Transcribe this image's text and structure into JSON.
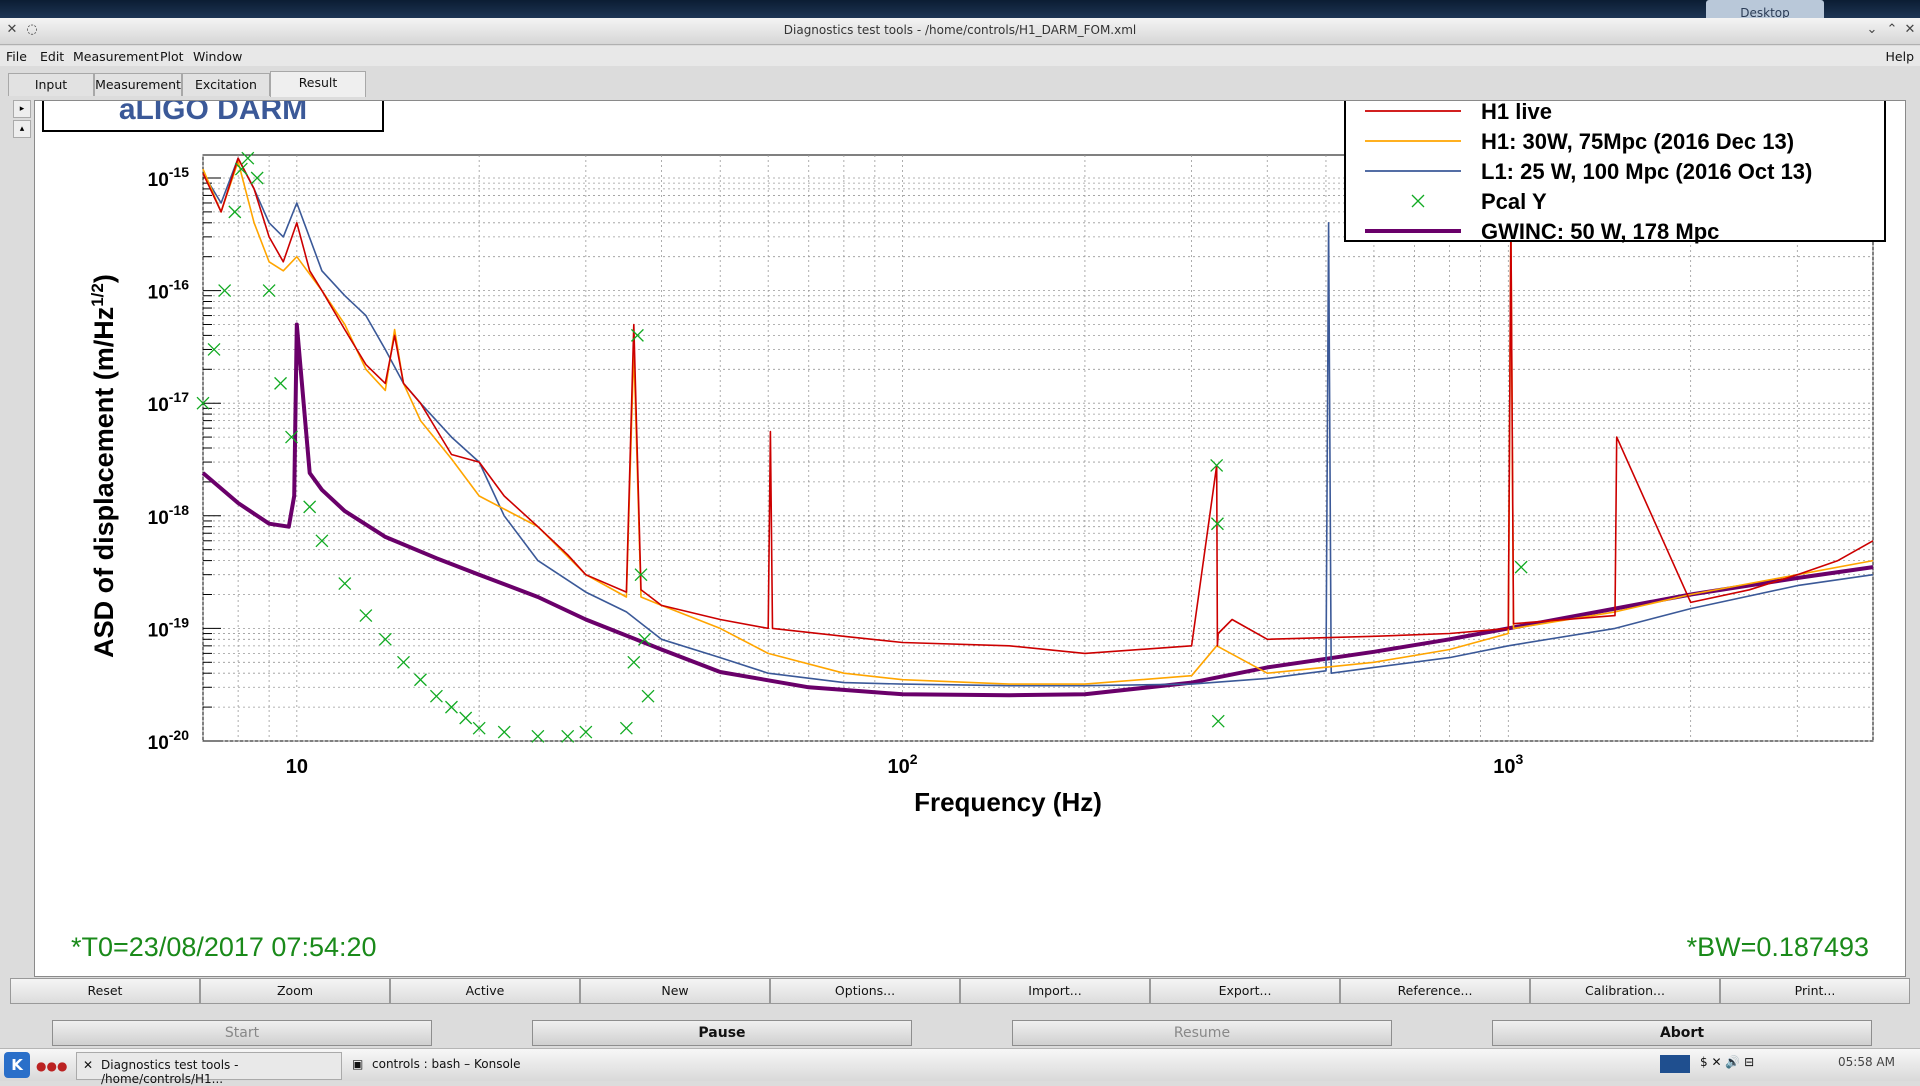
{
  "desktop_tab": "Desktop",
  "window_title": "Diagnostics test tools - /home/controls/H1_DARM_FOM.xml",
  "menu": [
    "File",
    "Edit",
    "Measurement",
    "Plot",
    "Window"
  ],
  "menu_help": "Help",
  "tabs": [
    "Input",
    "Measurement",
    "Excitation",
    "Result"
  ],
  "active_tab": "Result",
  "plot_title": "aLIGO DARM",
  "t0_label": "*T0=23/08/2017 07:54:20",
  "bw_label": "*BW=0.187493",
  "legend": [
    {
      "label": "H1 live",
      "color": "#cc0000",
      "kind": "line"
    },
    {
      "label": "H1: 30W, 75Mpc (2016 Dec 13)",
      "color": "#ffa500",
      "kind": "line"
    },
    {
      "label": "L1: 25 W, 100 Mpc (2016 Oct 13)",
      "color": "#3b5998",
      "kind": "line"
    },
    {
      "label": "Pcal Y",
      "color": "#11aa22",
      "kind": "marker"
    },
    {
      "label": "GWINC: 50 W, 178 Mpc",
      "color": "#6a006a",
      "kind": "thick"
    }
  ],
  "chart_data": {
    "type": "line",
    "xlabel": "Frequency (Hz)",
    "ylabel": "ASD of displacement (m/Hz^1/2)",
    "ylabel_main": "ASD of displacement (m/Hz",
    "ylabel_sup": "1/2",
    "ylabel_close": ")",
    "xscale": "log",
    "yscale": "log",
    "xlim": [
      7,
      4000
    ],
    "ylim": [
      1e-20,
      1.6e-15
    ],
    "x_ticks": [
      {
        "v": 10,
        "base": "10",
        "exp": ""
      },
      {
        "v": 100,
        "base": "10",
        "exp": "2"
      },
      {
        "v": 1000,
        "base": "10",
        "exp": "3"
      }
    ],
    "y_ticks": [
      {
        "v": 1e-15,
        "base": "10",
        "exp": "-15"
      },
      {
        "v": 1e-16,
        "base": "10",
        "exp": "-16"
      },
      {
        "v": 1e-17,
        "base": "10",
        "exp": "-17"
      },
      {
        "v": 1e-18,
        "base": "10",
        "exp": "-18"
      },
      {
        "v": 1e-19,
        "base": "10",
        "exp": "-19"
      },
      {
        "v": 1e-20,
        "base": "10",
        "exp": "-20"
      }
    ],
    "grid": true,
    "legend_position": "top-right",
    "series": [
      {
        "name": "GWINC: 50 W, 178 Mpc",
        "color": "#6a006a",
        "x": [
          7,
          8,
          9,
          9.7,
          9.9,
          10,
          10.5,
          11,
          12,
          14,
          17,
          20,
          25,
          30,
          40,
          50,
          70,
          100,
          150,
          200,
          300,
          400,
          600,
          800,
          1000,
          1500,
          2000,
          3000,
          4000
        ],
        "y": [
          2.4e-18,
          1.3e-18,
          8.5e-19,
          8e-19,
          1.5e-18,
          5e-17,
          2.4e-18,
          1.7e-18,
          1.1e-18,
          6.5e-19,
          4.2e-19,
          3e-19,
          1.9e-19,
          1.2e-19,
          6.5e-20,
          4.1e-20,
          3e-20,
          2.6e-20,
          2.55e-20,
          2.6e-20,
          3.3e-20,
          4.5e-20,
          6.2e-20,
          8e-20,
          1e-19,
          1.5e-19,
          2e-19,
          2.8e-19,
          3.5e-19
        ]
      },
      {
        "name": "L1: 25 W, 100 Mpc (2016 Oct 13)",
        "color": "#3b5998",
        "x": [
          7,
          7.5,
          8,
          8.5,
          9,
          9.5,
          10,
          11,
          12,
          13,
          14,
          15,
          16,
          18,
          20,
          22,
          25,
          30,
          35,
          40,
          50,
          60,
          80,
          100,
          150,
          200,
          300,
          400,
          500,
          505,
          510,
          600,
          800,
          1000,
          1500,
          2000,
          3000,
          4000
        ],
        "y": [
          1.1e-15,
          6e-16,
          1.5e-15,
          8e-16,
          4e-16,
          3e-16,
          6e-16,
          1.5e-16,
          9e-17,
          6e-17,
          3e-17,
          1.5e-17,
          1e-17,
          5e-18,
          3e-18,
          1e-18,
          4e-19,
          2.1e-19,
          1.4e-19,
          8e-20,
          5.5e-20,
          4e-20,
          3.3e-20,
          3.2e-20,
          3.1e-20,
          3.1e-20,
          3.2e-20,
          3.6e-20,
          4.2e-20,
          4e-16,
          4e-20,
          4.5e-20,
          5.5e-20,
          7e-20,
          1e-19,
          1.5e-19,
          2.4e-19,
          3e-19
        ]
      },
      {
        "name": "H1: 30W, 75Mpc (2016 Dec 13)",
        "color": "#ffa500",
        "x": [
          7,
          7.5,
          8,
          8.5,
          9,
          9.5,
          10,
          11,
          12,
          13,
          14,
          14.5,
          15,
          16,
          18,
          20,
          25,
          30,
          35,
          36,
          37,
          40,
          50,
          60,
          80,
          100,
          150,
          200,
          300,
          330,
          400,
          600,
          800,
          1000,
          1010,
          1020,
          1500,
          2000,
          3000,
          4000
        ],
        "y": [
          1.2e-15,
          5e-16,
          1.4e-15,
          4e-16,
          1.8e-16,
          1.5e-16,
          2e-16,
          1e-16,
          5e-17,
          2e-17,
          1.3e-17,
          4.5e-17,
          1.5e-17,
          7e-18,
          3.2e-18,
          1.5e-18,
          8e-19,
          3e-19,
          1.9e-19,
          3e-17,
          1.9e-19,
          1.6e-19,
          1e-19,
          6e-20,
          4e-20,
          3.5e-20,
          3.2e-20,
          3.2e-20,
          3.8e-20,
          7e-20,
          4e-20,
          5e-20,
          6.5e-20,
          9e-20,
          4e-16,
          1e-19,
          1.4e-19,
          2e-19,
          3e-19,
          4e-19
        ]
      },
      {
        "name": "H1 live",
        "color": "#cc0000",
        "x": [
          7,
          7.5,
          8,
          8.5,
          9,
          9.5,
          10,
          10.5,
          11,
          12,
          13,
          14,
          14.5,
          15,
          16,
          18,
          20,
          22,
          25,
          28,
          30,
          35,
          36,
          37,
          40,
          50,
          60,
          60.5,
          61,
          80,
          100,
          150,
          200,
          300,
          330,
          331,
          332,
          350,
          400,
          600,
          800,
          1000,
          1010,
          1020,
          1500,
          1510,
          2000,
          2500,
          3000,
          3500,
          4000
        ],
        "y": [
          1.1e-15,
          5e-16,
          1.5e-15,
          8e-16,
          3e-16,
          1.8e-16,
          4e-16,
          1.5e-16,
          1e-16,
          4.5e-17,
          2.2e-17,
          1.5e-17,
          4e-17,
          1.5e-17,
          1e-17,
          3.5e-18,
          3e-18,
          1.5e-18,
          8e-19,
          4.5e-19,
          3e-19,
          2.1e-19,
          5e-17,
          2.2e-19,
          1.6e-19,
          1.2e-19,
          1e-19,
          5.6e-18,
          1e-19,
          8.5e-20,
          7.5e-20,
          7e-20,
          6e-20,
          7e-20,
          2.8e-18,
          7e-20,
          9e-20,
          1.2e-19,
          8e-20,
          8.5e-20,
          9e-20,
          1e-19,
          4e-16,
          1.1e-19,
          1.3e-19,
          5e-18,
          1.7e-19,
          2.2e-19,
          3e-19,
          4e-19,
          6e-19
        ]
      },
      {
        "name": "Pcal Y",
        "color": "#11aa22",
        "marker": "x",
        "x": [
          7,
          7.3,
          7.6,
          7.9,
          8.1,
          8.3,
          8.6,
          9,
          9.4,
          9.8,
          10.5,
          11,
          12,
          13,
          14,
          15,
          16,
          17,
          18,
          19,
          20,
          22,
          25,
          28,
          30,
          35,
          36,
          36.5,
          37,
          37.5,
          38,
          330,
          331,
          332,
          1050
        ],
        "y": [
          1e-17,
          3e-17,
          1e-16,
          5e-16,
          1.2e-15,
          1.5e-15,
          1e-15,
          1e-16,
          1.5e-17,
          5e-18,
          1.2e-18,
          6e-19,
          2.5e-19,
          1.3e-19,
          8e-20,
          5e-20,
          3.5e-20,
          2.5e-20,
          2e-20,
          1.6e-20,
          1.3e-20,
          1.2e-20,
          1.1e-20,
          1.1e-20,
          1.2e-20,
          1.3e-20,
          5e-20,
          4e-17,
          3e-19,
          8e-20,
          2.5e-20,
          2.8e-18,
          8.5e-19,
          1.5e-20,
          3.5e-19
        ]
      }
    ]
  },
  "toolbar": [
    "Reset",
    "Zoom",
    "Active",
    "New",
    "Options...",
    "Import...",
    "Export...",
    "Reference...",
    "Calibration...",
    "Print..."
  ],
  "controls": [
    "Start",
    "Pause",
    "Resume",
    "Abort"
  ],
  "taskbar": {
    "app1": "Diagnostics test tools - /home/controls/H1...",
    "app2": "controls : bash – Konsole",
    "clock": "05:58 AM"
  }
}
